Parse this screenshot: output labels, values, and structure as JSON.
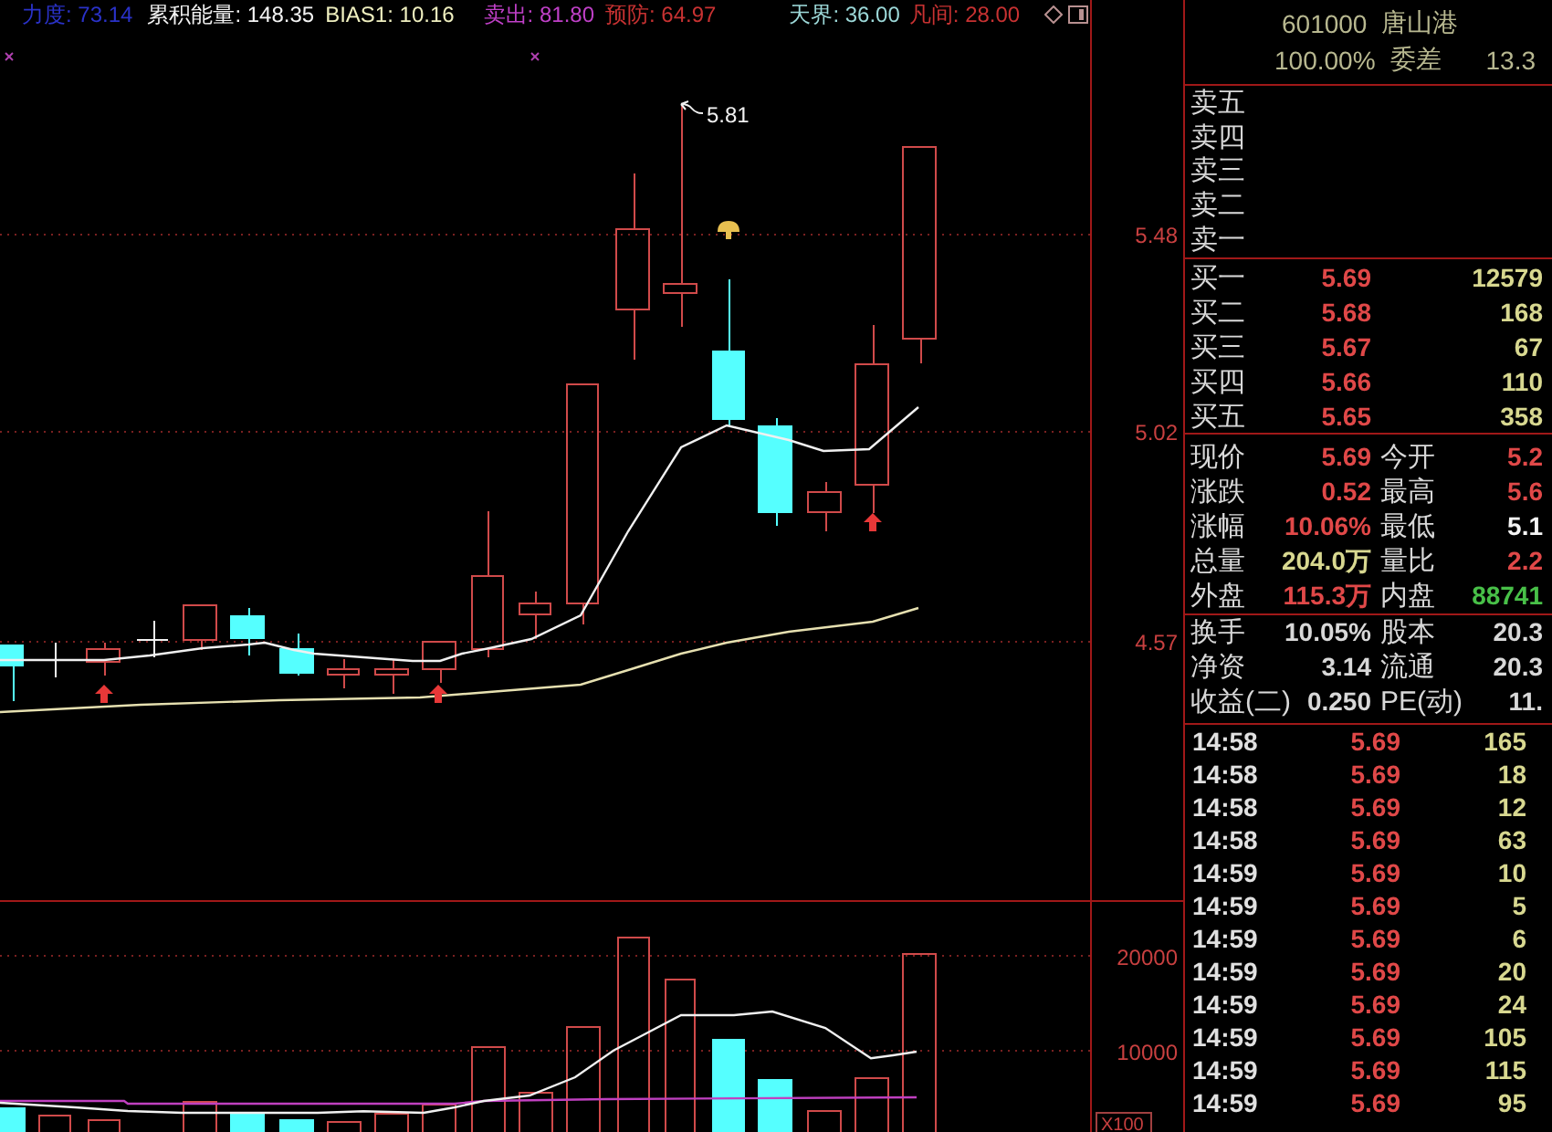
{
  "indicators": [
    {
      "text": "力度: 73.14",
      "color": "#2a32c8"
    },
    {
      "text": "累积能量: 148.35",
      "color": "#f4f4f4"
    },
    {
      "text": "BIAS1: 10.16",
      "color": "#f0f0c0"
    },
    {
      "text": "卖出: 81.80",
      "color": "#c040c8"
    },
    {
      "text": "预防: 64.97",
      "color": "#c83232"
    },
    {
      "text": "天界: 36.00",
      "color": "#9cd8d8"
    },
    {
      "text": "凡间: 28.00",
      "color": "#c83232"
    }
  ],
  "price_chart": {
    "axis_labels": [
      "5.48",
      "5.02",
      "4.57"
    ],
    "high_label": "5.81"
  },
  "volume_chart": {
    "axis_labels": [
      "20000",
      "10000"
    ],
    "unit": "X100"
  },
  "quote_header": {
    "code": "601000",
    "name": "唐山港",
    "ratio": "100.00%",
    "diff_label": "委差",
    "diff": "13.3"
  },
  "asks": [
    {
      "label": "卖五"
    },
    {
      "label": "卖四"
    },
    {
      "label": "卖三"
    },
    {
      "label": "卖二"
    },
    {
      "label": "卖一"
    }
  ],
  "bids": [
    {
      "label": "买一",
      "price": "5.69",
      "volume": "12579"
    },
    {
      "label": "买二",
      "price": "5.68",
      "volume": "168"
    },
    {
      "label": "买三",
      "price": "5.67",
      "volume": "67"
    },
    {
      "label": "买四",
      "price": "5.66",
      "volume": "110"
    },
    {
      "label": "买五",
      "price": "5.65",
      "volume": "358"
    }
  ],
  "stats": [
    {
      "left": {
        "label": "现价",
        "value": "5.69",
        "color": "#e04848"
      },
      "right": {
        "label": "今开",
        "value": "5.2",
        "color": "#e04848"
      }
    },
    {
      "left": {
        "label": "涨跌",
        "value": "0.52",
        "color": "#e04848"
      },
      "right": {
        "label": "最高",
        "value": "5.6",
        "color": "#e04848"
      }
    },
    {
      "left": {
        "label": "涨幅",
        "value": "10.06%",
        "color": "#e04848"
      },
      "right": {
        "label": "最低",
        "value": "5.1",
        "color": "#f4f4f4"
      }
    },
    {
      "left": {
        "label": "总量",
        "value": "204.0万",
        "color": "#d8d890"
      },
      "right": {
        "label": "量比",
        "value": "2.2",
        "color": "#e04848"
      }
    },
    {
      "left": {
        "label": "外盘",
        "value": "115.3万",
        "color": "#e04848"
      },
      "right": {
        "label": "内盘",
        "value": "88741",
        "color": "#48c048"
      }
    }
  ],
  "fundamentals": [
    {
      "left": {
        "label": "换手",
        "value": "10.05%"
      },
      "right": {
        "label": "股本",
        "value": "20.3"
      }
    },
    {
      "left": {
        "label": "净资",
        "value": "3.14"
      },
      "right": {
        "label": "流通",
        "value": "20.3"
      }
    },
    {
      "left": {
        "label": "收益(二)",
        "value": "0.250"
      },
      "right": {
        "label": "PE(动)",
        "value": "11."
      }
    }
  ],
  "ticks": [
    {
      "time": "14:58",
      "price": "5.69",
      "volume": "165"
    },
    {
      "time": "14:58",
      "price": "5.69",
      "volume": "18"
    },
    {
      "time": "14:58",
      "price": "5.69",
      "volume": "12"
    },
    {
      "time": "14:58",
      "price": "5.69",
      "volume": "63"
    },
    {
      "time": "14:59",
      "price": "5.69",
      "volume": "10"
    },
    {
      "time": "14:59",
      "price": "5.69",
      "volume": "5"
    },
    {
      "time": "14:59",
      "price": "5.69",
      "volume": "6"
    },
    {
      "time": "14:59",
      "price": "5.69",
      "volume": "20"
    },
    {
      "time": "14:59",
      "price": "5.69",
      "volume": "24"
    },
    {
      "time": "14:59",
      "price": "5.69",
      "volume": "105"
    },
    {
      "time": "14:59",
      "price": "5.69",
      "volume": "115"
    },
    {
      "time": "14:59",
      "price": "5.69",
      "volume": "95"
    }
  ]
}
